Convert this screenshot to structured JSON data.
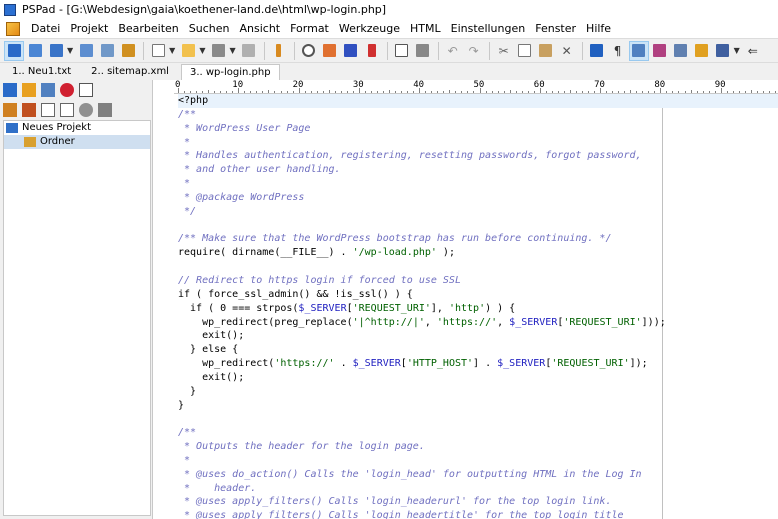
{
  "window": {
    "title": "PSPad - [G:\\Webdesign\\gaia\\koethener-land.de\\html\\wp-login.php]"
  },
  "menu": [
    "Datei",
    "Projekt",
    "Bearbeiten",
    "Suchen",
    "Ansicht",
    "Format",
    "Werkzeuge",
    "HTML",
    "Einstellungen",
    "Fenster",
    "Hilfe"
  ],
  "tabs": [
    "1.. Neu1.txt",
    "2.. sitemap.xml",
    "3.. wp-login.php"
  ],
  "tree": {
    "project": "Neues Projekt",
    "folder": "Ordner"
  },
  "ruler": [
    "0",
    "10",
    "20",
    "30",
    "40",
    "50",
    "60",
    "70",
    "80",
    "90"
  ],
  "code": [
    [
      [
        "plain",
        "<?php"
      ]
    ],
    [
      [
        "cm",
        "/**"
      ]
    ],
    [
      [
        "cm",
        " * WordPress User Page"
      ]
    ],
    [
      [
        "cm",
        " *"
      ]
    ],
    [
      [
        "cm",
        " * Handles authentication, registering, resetting passwords, forgot password,"
      ]
    ],
    [
      [
        "cm",
        " * and other user handling."
      ]
    ],
    [
      [
        "cm",
        " *"
      ]
    ],
    [
      [
        "cm",
        " * @package WordPress"
      ]
    ],
    [
      [
        "cm",
        " */"
      ]
    ],
    [
      [
        "plain",
        ""
      ]
    ],
    [
      [
        "cm",
        "/** Make sure that the WordPress bootstrap has run before continuing. */"
      ]
    ],
    [
      [
        "plain",
        "require( dirname(__FILE__) . "
      ],
      [
        "str",
        "'/wp-load.php'"
      ],
      [
        "plain",
        " );"
      ]
    ],
    [
      [
        "plain",
        ""
      ]
    ],
    [
      [
        "cm",
        "// Redirect to https login if forced to use SSL"
      ]
    ],
    [
      [
        "plain",
        "if ( force_ssl_admin() && !is_ssl() ) {"
      ]
    ],
    [
      [
        "plain",
        "  if ( 0 === strpos("
      ],
      [
        "var",
        "$_SERVER"
      ],
      [
        "plain",
        "["
      ],
      [
        "str",
        "'REQUEST_URI'"
      ],
      [
        "plain",
        "], "
      ],
      [
        "str",
        "'http'"
      ],
      [
        "plain",
        ") ) {"
      ]
    ],
    [
      [
        "plain",
        "    wp_redirect(preg_replace("
      ],
      [
        "str",
        "'|^http://|'"
      ],
      [
        "plain",
        ", "
      ],
      [
        "str",
        "'https://'"
      ],
      [
        "plain",
        ", "
      ],
      [
        "var",
        "$_SERVER"
      ],
      [
        "plain",
        "["
      ],
      [
        "str",
        "'REQUEST_URI'"
      ],
      [
        "plain",
        "]));"
      ]
    ],
    [
      [
        "plain",
        "    exit();"
      ]
    ],
    [
      [
        "plain",
        "  } else {"
      ]
    ],
    [
      [
        "plain",
        "    wp_redirect("
      ],
      [
        "str",
        "'https://'"
      ],
      [
        "plain",
        " . "
      ],
      [
        "var",
        "$_SERVER"
      ],
      [
        "plain",
        "["
      ],
      [
        "str",
        "'HTTP_HOST'"
      ],
      [
        "plain",
        "] . "
      ],
      [
        "var",
        "$_SERVER"
      ],
      [
        "plain",
        "["
      ],
      [
        "str",
        "'REQUEST_URI'"
      ],
      [
        "plain",
        "]);"
      ]
    ],
    [
      [
        "plain",
        "    exit();"
      ]
    ],
    [
      [
        "plain",
        "  }"
      ]
    ],
    [
      [
        "plain",
        "}"
      ]
    ],
    [
      [
        "plain",
        ""
      ]
    ],
    [
      [
        "cm",
        "/**"
      ]
    ],
    [
      [
        "cm",
        " * Outputs the header for the login page."
      ]
    ],
    [
      [
        "cm",
        " *"
      ]
    ],
    [
      [
        "cm",
        " * @uses do_action() Calls the 'login_head' for outputting HTML in the Log In"
      ]
    ],
    [
      [
        "cm",
        " *    header."
      ]
    ],
    [
      [
        "cm",
        " * @uses apply_filters() Calls 'login_headerurl' for the top login link."
      ]
    ],
    [
      [
        "cm",
        " * @uses apply_filters() Calls 'login_headertitle' for the top login title"
      ]
    ]
  ]
}
